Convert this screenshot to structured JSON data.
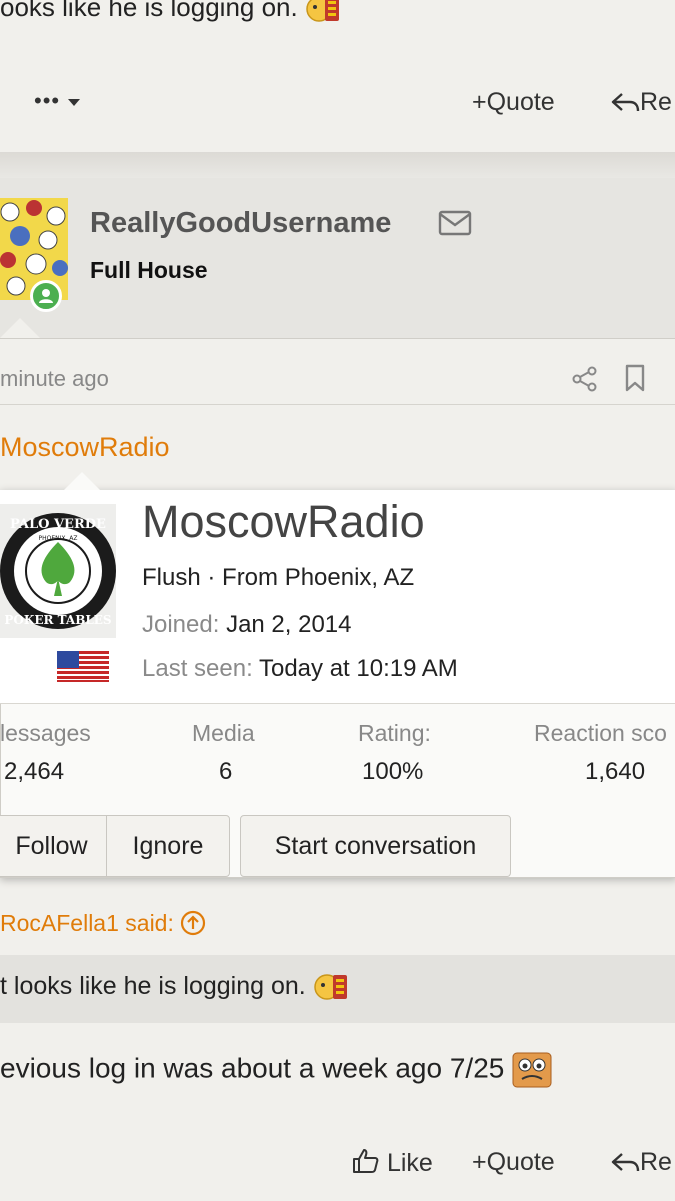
{
  "top_post": {
    "text": "ooks like he is logging on.",
    "more_label": "•••",
    "quote_label": "Quote",
    "reply_label": "Re"
  },
  "post": {
    "username": "ReallyGoodUsername",
    "user_title": "Full House",
    "timestamp": "minute ago",
    "quoted_author_partial": "MoscowRadio"
  },
  "member_card": {
    "name": "MoscowRadio",
    "rank": "Flush",
    "location_prefix": "From",
    "location": "Phoenix, AZ",
    "joined_label": "Joined:",
    "joined_value": "Jan 2, 2014",
    "last_seen_label": "Last seen:",
    "last_seen_value": "Today at 10:19 AM",
    "logo_text_top": "PALO VERDE",
    "logo_text_mid": "PHOENIX, AZ",
    "logo_text_bottom": "POKER TABLES",
    "stats": [
      {
        "label": "lessages",
        "value": "2,464"
      },
      {
        "label": "Media",
        "value": "6"
      },
      {
        "label": "Rating:",
        "value": "100%"
      },
      {
        "label": "Reaction sco",
        "value": "1,640"
      }
    ],
    "buttons": {
      "follow": "Follow",
      "ignore": "Ignore",
      "start_conversation": "Start conversation"
    }
  },
  "quote": {
    "author_label": "RocAFella1 said:",
    "text": "t looks like he is logging on."
  },
  "reply": {
    "text": "evious log in was about a week ago 7/25"
  },
  "bottom_actions": {
    "like_label": "Like",
    "quote_label": "Quote",
    "reply_label": "Re"
  },
  "colors": {
    "accent_orange": "#e07c0a",
    "online_green": "#4caf50"
  }
}
